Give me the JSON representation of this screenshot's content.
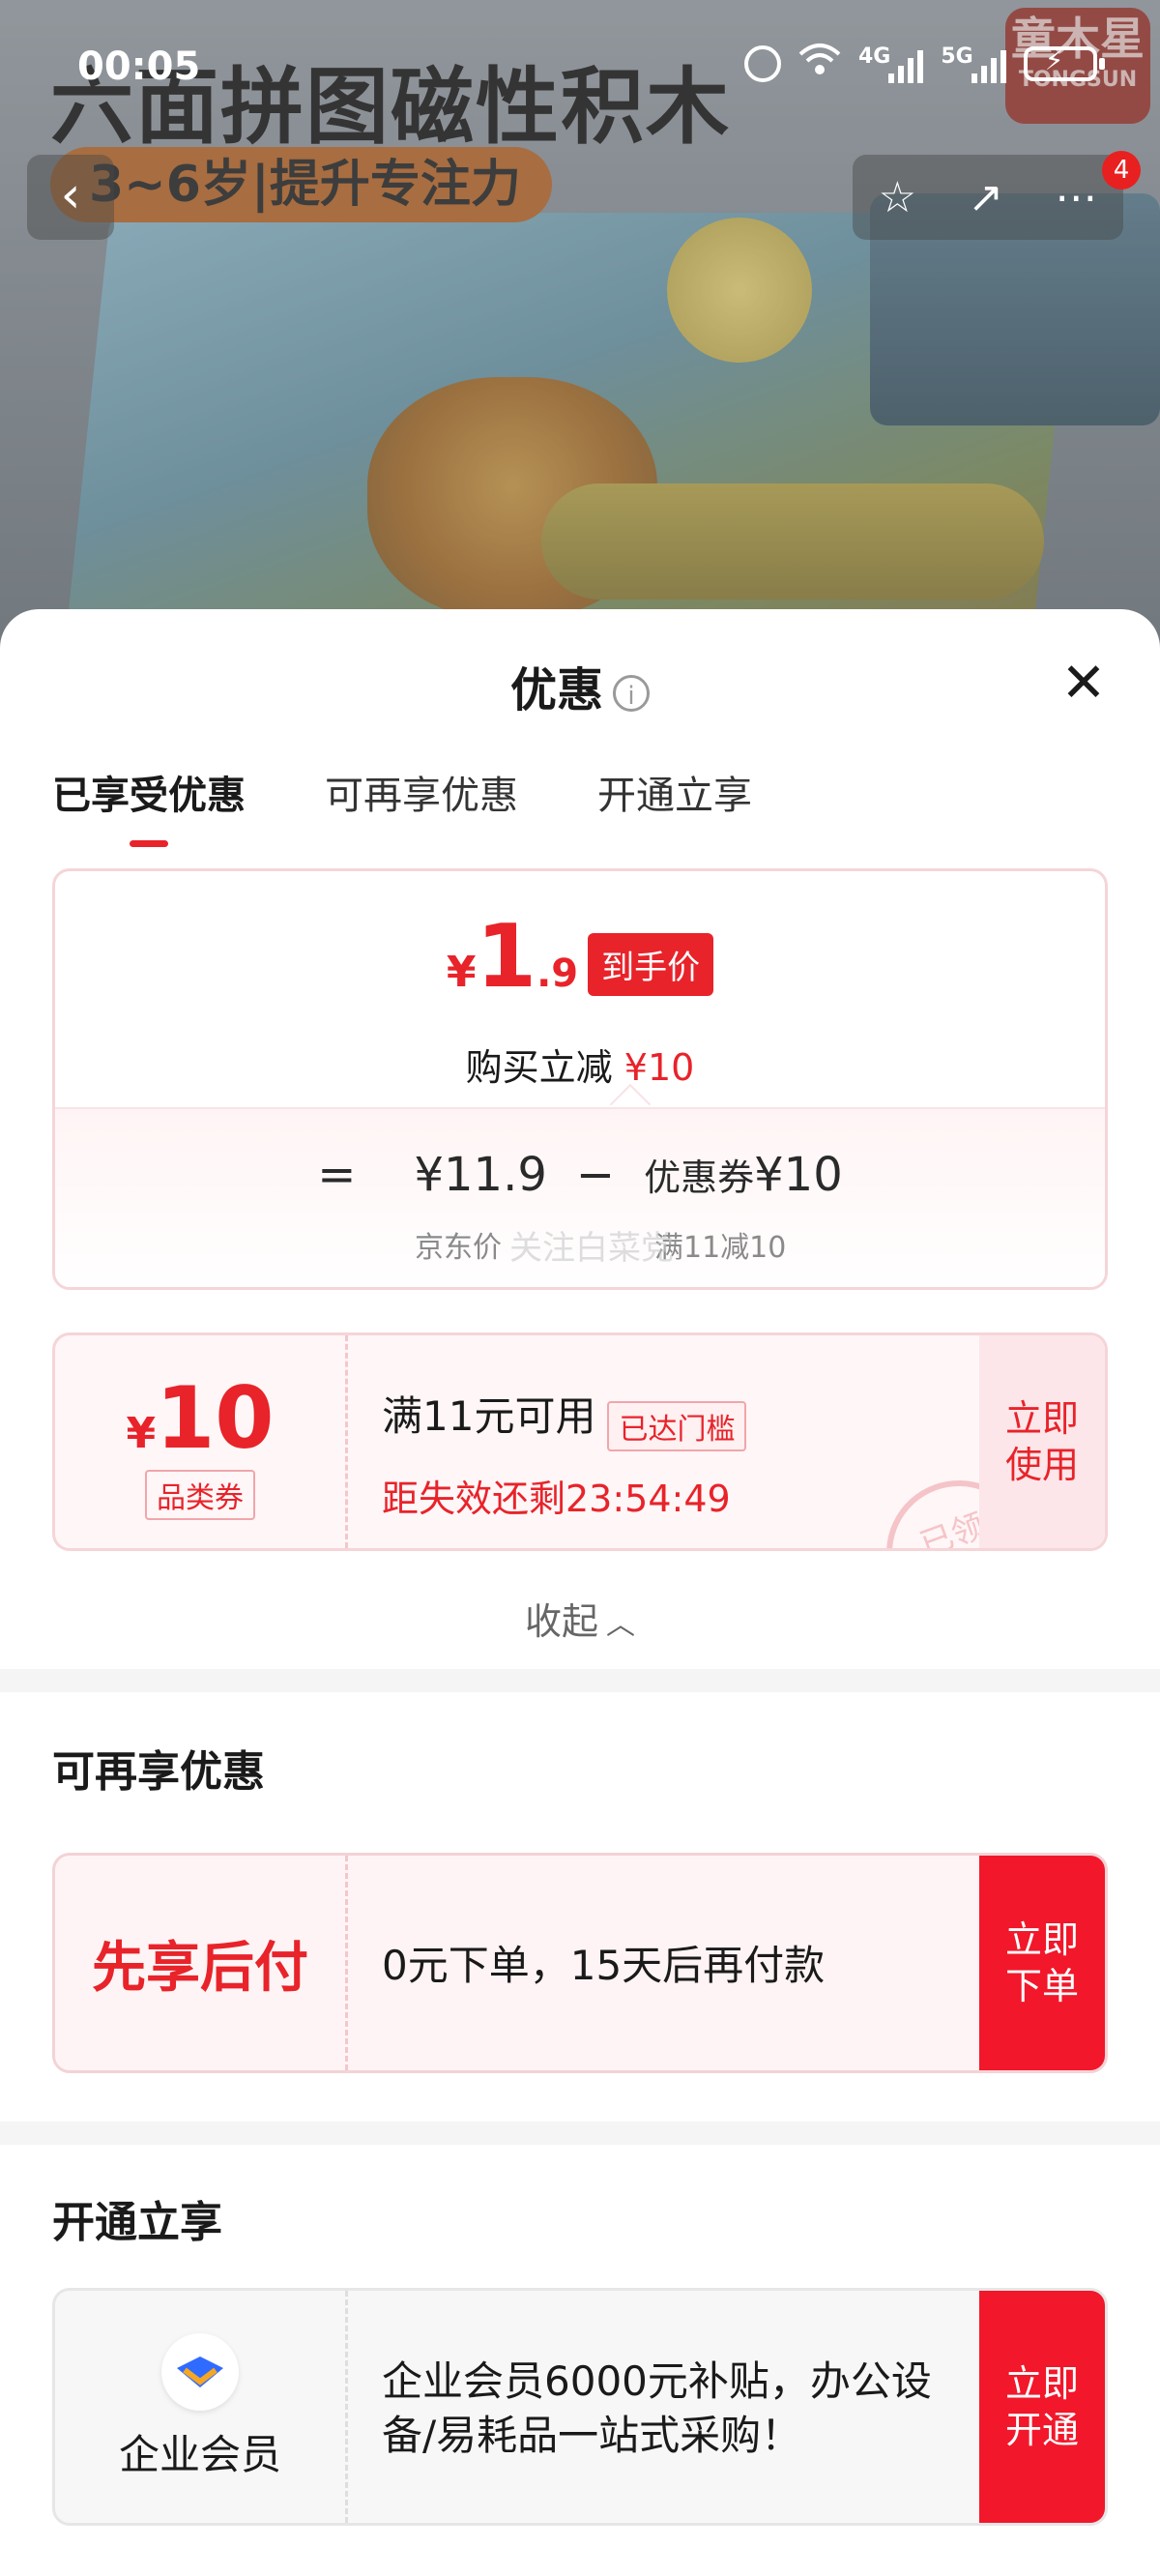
{
  "status_bar": {
    "time": "00:05",
    "net1": "4G",
    "net2": "5G"
  },
  "product_bg": {
    "title": "六面拼图磁性积木",
    "tag": "3~6岁|提升专注力",
    "brand": "童木星",
    "brand_sub": "TONGSUN"
  },
  "nav": {
    "cart_badge": "4"
  },
  "sheet": {
    "title": "优惠",
    "tabs": [
      {
        "label": "已享受优惠",
        "active": true
      },
      {
        "label": "可再享优惠",
        "active": false
      },
      {
        "label": "开通立享",
        "active": false
      }
    ],
    "summary": {
      "currency": "¥",
      "price_int": "1",
      "price_dec": ".9",
      "price_tag": "到手价",
      "reduce_label": "购买立减",
      "reduce_value": "¥10",
      "equals": "=",
      "jd_price": "¥11.9",
      "minus": "−",
      "coupon_label": "优惠券",
      "coupon_value": "¥10",
      "jd_price_label": "京东价",
      "coupon_rule": "满11减10",
      "watermark": "关注白菜党"
    },
    "coupon": {
      "currency": "¥",
      "amount": "10",
      "type": "品类券",
      "condition": "满11元可用",
      "reached": "已达门槛",
      "expire": "距失效还剩23:54:49",
      "button": "立即\n使用",
      "stamp": "已领"
    },
    "collapse": "收起",
    "more_offers": {
      "title": "可再享优惠",
      "label": "先享后付",
      "text": "0元下单，15天后再付款",
      "button": "立即\n下单"
    },
    "activate": {
      "title": "开通立享",
      "label": "企业会员",
      "text": "企业会员6000元补贴，办公设备/易耗品一站式采购！",
      "button": "立即\n开通"
    }
  },
  "colors": {
    "accent": "#e8232a",
    "button_red": "#f2172a",
    "card_bg": "#fff4f5"
  }
}
